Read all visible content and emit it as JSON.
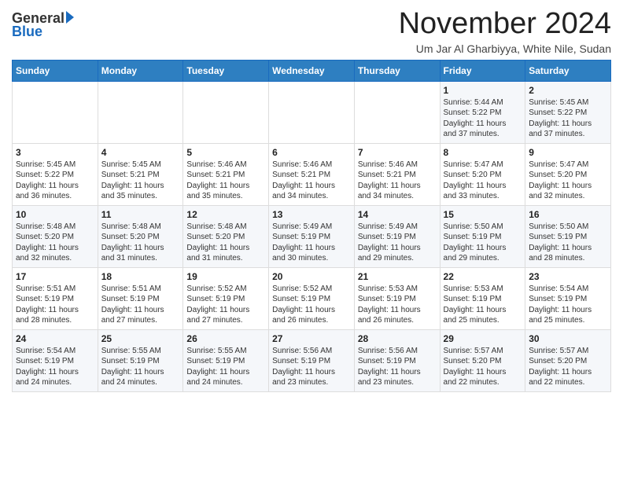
{
  "logo": {
    "general": "General",
    "blue": "Blue"
  },
  "title": "November 2024",
  "location": "Um Jar Al Gharbiyya, White Nile, Sudan",
  "weekdays": [
    "Sunday",
    "Monday",
    "Tuesday",
    "Wednesday",
    "Thursday",
    "Friday",
    "Saturday"
  ],
  "weeks": [
    [
      {
        "day": "",
        "info": ""
      },
      {
        "day": "",
        "info": ""
      },
      {
        "day": "",
        "info": ""
      },
      {
        "day": "",
        "info": ""
      },
      {
        "day": "",
        "info": ""
      },
      {
        "day": "1",
        "info": "Sunrise: 5:44 AM\nSunset: 5:22 PM\nDaylight: 11 hours\nand 37 minutes."
      },
      {
        "day": "2",
        "info": "Sunrise: 5:45 AM\nSunset: 5:22 PM\nDaylight: 11 hours\nand 37 minutes."
      }
    ],
    [
      {
        "day": "3",
        "info": "Sunrise: 5:45 AM\nSunset: 5:22 PM\nDaylight: 11 hours\nand 36 minutes."
      },
      {
        "day": "4",
        "info": "Sunrise: 5:45 AM\nSunset: 5:21 PM\nDaylight: 11 hours\nand 35 minutes."
      },
      {
        "day": "5",
        "info": "Sunrise: 5:46 AM\nSunset: 5:21 PM\nDaylight: 11 hours\nand 35 minutes."
      },
      {
        "day": "6",
        "info": "Sunrise: 5:46 AM\nSunset: 5:21 PM\nDaylight: 11 hours\nand 34 minutes."
      },
      {
        "day": "7",
        "info": "Sunrise: 5:46 AM\nSunset: 5:21 PM\nDaylight: 11 hours\nand 34 minutes."
      },
      {
        "day": "8",
        "info": "Sunrise: 5:47 AM\nSunset: 5:20 PM\nDaylight: 11 hours\nand 33 minutes."
      },
      {
        "day": "9",
        "info": "Sunrise: 5:47 AM\nSunset: 5:20 PM\nDaylight: 11 hours\nand 32 minutes."
      }
    ],
    [
      {
        "day": "10",
        "info": "Sunrise: 5:48 AM\nSunset: 5:20 PM\nDaylight: 11 hours\nand 32 minutes."
      },
      {
        "day": "11",
        "info": "Sunrise: 5:48 AM\nSunset: 5:20 PM\nDaylight: 11 hours\nand 31 minutes."
      },
      {
        "day": "12",
        "info": "Sunrise: 5:48 AM\nSunset: 5:20 PM\nDaylight: 11 hours\nand 31 minutes."
      },
      {
        "day": "13",
        "info": "Sunrise: 5:49 AM\nSunset: 5:19 PM\nDaylight: 11 hours\nand 30 minutes."
      },
      {
        "day": "14",
        "info": "Sunrise: 5:49 AM\nSunset: 5:19 PM\nDaylight: 11 hours\nand 29 minutes."
      },
      {
        "day": "15",
        "info": "Sunrise: 5:50 AM\nSunset: 5:19 PM\nDaylight: 11 hours\nand 29 minutes."
      },
      {
        "day": "16",
        "info": "Sunrise: 5:50 AM\nSunset: 5:19 PM\nDaylight: 11 hours\nand 28 minutes."
      }
    ],
    [
      {
        "day": "17",
        "info": "Sunrise: 5:51 AM\nSunset: 5:19 PM\nDaylight: 11 hours\nand 28 minutes."
      },
      {
        "day": "18",
        "info": "Sunrise: 5:51 AM\nSunset: 5:19 PM\nDaylight: 11 hours\nand 27 minutes."
      },
      {
        "day": "19",
        "info": "Sunrise: 5:52 AM\nSunset: 5:19 PM\nDaylight: 11 hours\nand 27 minutes."
      },
      {
        "day": "20",
        "info": "Sunrise: 5:52 AM\nSunset: 5:19 PM\nDaylight: 11 hours\nand 26 minutes."
      },
      {
        "day": "21",
        "info": "Sunrise: 5:53 AM\nSunset: 5:19 PM\nDaylight: 11 hours\nand 26 minutes."
      },
      {
        "day": "22",
        "info": "Sunrise: 5:53 AM\nSunset: 5:19 PM\nDaylight: 11 hours\nand 25 minutes."
      },
      {
        "day": "23",
        "info": "Sunrise: 5:54 AM\nSunset: 5:19 PM\nDaylight: 11 hours\nand 25 minutes."
      }
    ],
    [
      {
        "day": "24",
        "info": "Sunrise: 5:54 AM\nSunset: 5:19 PM\nDaylight: 11 hours\nand 24 minutes."
      },
      {
        "day": "25",
        "info": "Sunrise: 5:55 AM\nSunset: 5:19 PM\nDaylight: 11 hours\nand 24 minutes."
      },
      {
        "day": "26",
        "info": "Sunrise: 5:55 AM\nSunset: 5:19 PM\nDaylight: 11 hours\nand 24 minutes."
      },
      {
        "day": "27",
        "info": "Sunrise: 5:56 AM\nSunset: 5:19 PM\nDaylight: 11 hours\nand 23 minutes."
      },
      {
        "day": "28",
        "info": "Sunrise: 5:56 AM\nSunset: 5:19 PM\nDaylight: 11 hours\nand 23 minutes."
      },
      {
        "day": "29",
        "info": "Sunrise: 5:57 AM\nSunset: 5:20 PM\nDaylight: 11 hours\nand 22 minutes."
      },
      {
        "day": "30",
        "info": "Sunrise: 5:57 AM\nSunset: 5:20 PM\nDaylight: 11 hours\nand 22 minutes."
      }
    ]
  ]
}
